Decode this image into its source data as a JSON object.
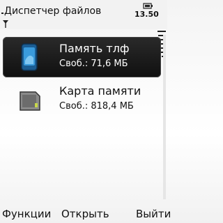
{
  "header": {
    "title": "Диспетчер файлов",
    "time": "13.50",
    "icons": [
      "antenna-icon",
      "battery-icon"
    ]
  },
  "list": {
    "items": [
      {
        "label": "Память тлф",
        "sub": "Своб.: 71,6 МБ",
        "icon": "phone-memory-icon",
        "selected": true
      },
      {
        "label": "Карта памяти",
        "sub": "Своб.: 818,4 МБ",
        "icon": "memory-card-icon",
        "selected": false
      }
    ]
  },
  "softkeys": {
    "left": "Функции",
    "center": "Открыть",
    "right": "Выйти"
  },
  "colors": {
    "selection_bg": "#161616",
    "selected_text": "#ffffff",
    "text": "#111111",
    "phone_icon_blue": "#3a9bdc"
  }
}
